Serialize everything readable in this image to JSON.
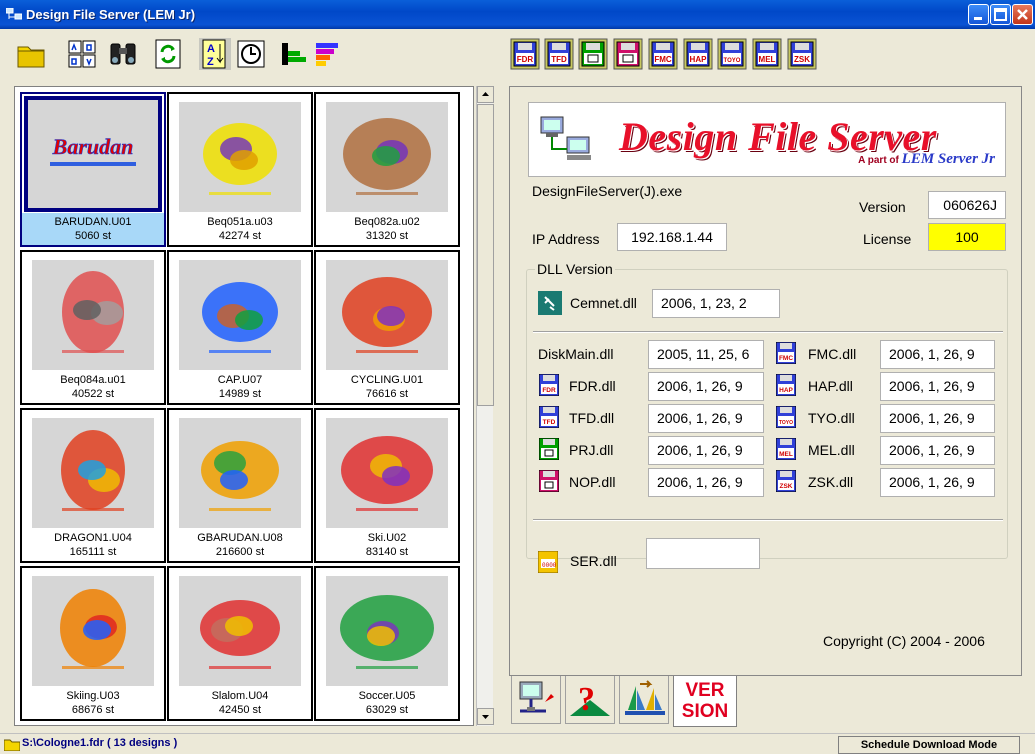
{
  "window": {
    "title": "Design File Server (LEM Jr)"
  },
  "toolbar": {
    "left_icons": [
      "folder-open-icon",
      "grid-view-icon",
      "binoculars-icon",
      "refresh-icon",
      "sort-az-icon",
      "sort-time-icon",
      "sort-size-icon",
      "sort-color-icon"
    ],
    "right_icons": [
      "FDR",
      "TFD",
      "PRJ",
      "NOP",
      "FMC",
      "HAP",
      "TOYO",
      "MEL",
      "ZSK"
    ]
  },
  "designs": [
    {
      "name": "BARUDAN.U01",
      "stitches": "5060 st",
      "selected": true,
      "art": "Barudan"
    },
    {
      "name": "Beq051a.u03",
      "stitches": "42274 st"
    },
    {
      "name": "Beq082a.u02",
      "stitches": "31320 st"
    },
    {
      "name": "Beq084a.u01",
      "stitches": "40522 st"
    },
    {
      "name": "CAP.U07",
      "stitches": "14989 st"
    },
    {
      "name": "CYCLING.U01",
      "stitches": "76616 st"
    },
    {
      "name": "DRAGON1.U04",
      "stitches": "165111 st"
    },
    {
      "name": "GBARUDAN.U08",
      "stitches": "216600 st"
    },
    {
      "name": "Ski.U02",
      "stitches": "83140 st"
    },
    {
      "name": "Skiing.U03",
      "stitches": "68676 st"
    },
    {
      "name": "Slalom.U04",
      "stitches": "42450 st"
    },
    {
      "name": "Soccer.U05",
      "stitches": "63029 st"
    }
  ],
  "info": {
    "banner_title": "Design File Server",
    "banner_sub_prefix": "A part of",
    "banner_sub_brand": "LEM Server Jr",
    "exe": "DesignFileServer(J).exe",
    "version_label": "Version",
    "version": "060626J",
    "ip_label": "IP Address",
    "ip": "192.168.1.44",
    "license_label": "License",
    "license": "100",
    "dll_group": "DLL Version",
    "cemnet": {
      "name": "Cemnet.dll",
      "version": "2006, 1, 23, 2"
    },
    "dlls_left": [
      {
        "name": "DiskMain.dll",
        "version": "2005, 11, 25, 6",
        "icon": ""
      },
      {
        "name": "FDR.dll",
        "version": "2006, 1, 26, 9",
        "icon": "FDR"
      },
      {
        "name": "TFD.dll",
        "version": "2006, 1, 26, 9",
        "icon": "TFD"
      },
      {
        "name": "PRJ.dll",
        "version": "2006, 1, 26, 9",
        "icon": "PRJ"
      },
      {
        "name": "NOP.dll",
        "version": "2006, 1, 26, 9",
        "icon": "NOP"
      }
    ],
    "dlls_right": [
      {
        "name": "FMC.dll",
        "version": "2006, 1, 26, 9",
        "icon": "FMC"
      },
      {
        "name": "HAP.dll",
        "version": "2006, 1, 26, 9",
        "icon": "HAP"
      },
      {
        "name": "TYO.dll",
        "version": "2006, 1, 26, 9",
        "icon": "TOYO"
      },
      {
        "name": "MEL.dll",
        "version": "2006, 1, 26, 9",
        "icon": "MEL"
      },
      {
        "name": "ZSK.dll",
        "version": "2006, 1, 26, 9",
        "icon": "ZSK"
      }
    ],
    "ser": {
      "name": "SER.dll",
      "version": ""
    },
    "copyright": "Copyright (C) 2004 - 2006"
  },
  "bottom_tabs": [
    {
      "icon": "network-computer-icon"
    },
    {
      "icon": "help-icon"
    },
    {
      "icon": "sailboats-icon"
    },
    {
      "label": "VER\nSION",
      "icon": "version-icon",
      "active": true
    }
  ],
  "status": {
    "path": "S:\\Cologne1.fdr ( 13 designs )",
    "mode": "Schedule Download Mode"
  },
  "colors": {
    "titlebar": "#0a53d4",
    "selection": "#000080",
    "license_bg": "#ffff00",
    "banner_title": "#e8102a"
  }
}
